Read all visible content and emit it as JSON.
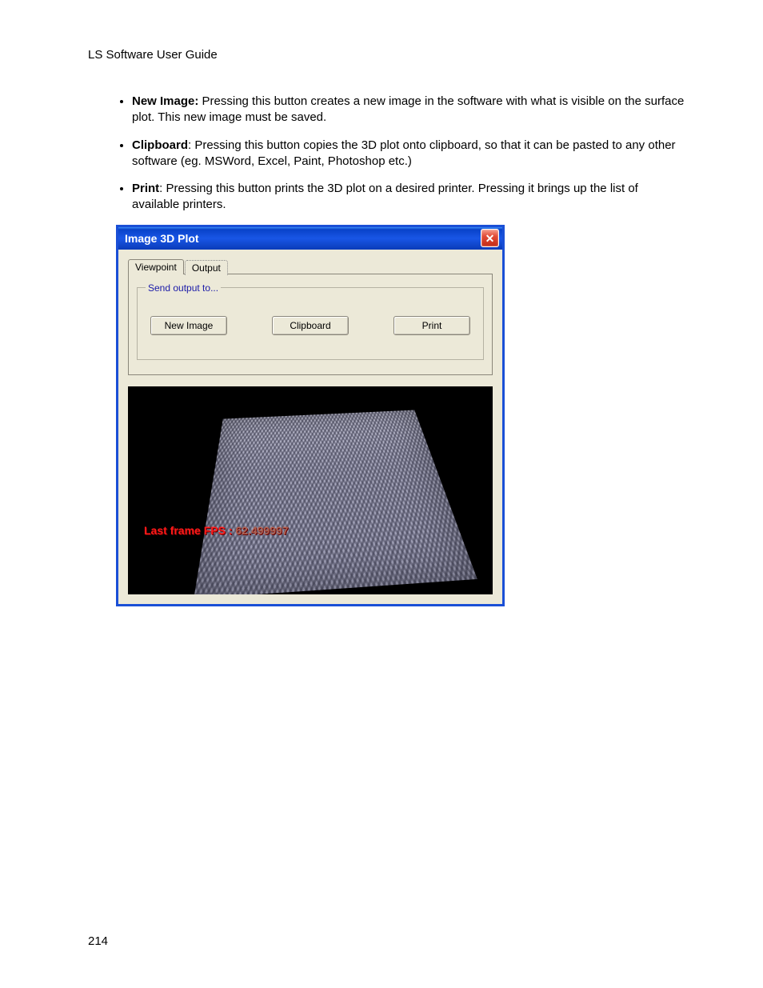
{
  "doc": {
    "header": "LS Software User Guide",
    "page_number": "214"
  },
  "bullets": [
    {
      "term": "New Image:",
      "text": " Pressing this button creates a new image in the software  with what is visible on the surface plot. This new image must be saved."
    },
    {
      "term": "Clipboard",
      "text": ": Pressing this button copies the 3D plot onto clipboard, so that it can be pasted to any other software (eg. MSWord, Excel, Paint, Photoshop etc.)"
    },
    {
      "term": "Print",
      "text": ": Pressing this button prints the 3D plot on a desired printer. Pressing it brings up the list of available printers."
    }
  ],
  "window": {
    "title": "Image 3D Plot",
    "tabs": {
      "viewpoint": "Viewpoint",
      "output": "Output"
    },
    "groupbox_legend": "Send output to...",
    "buttons": {
      "new_image": "New Image",
      "clipboard": "Clipboard",
      "print": "Print"
    },
    "fps_label": "Last frame FPS :",
    "fps_value": "62.499997"
  }
}
